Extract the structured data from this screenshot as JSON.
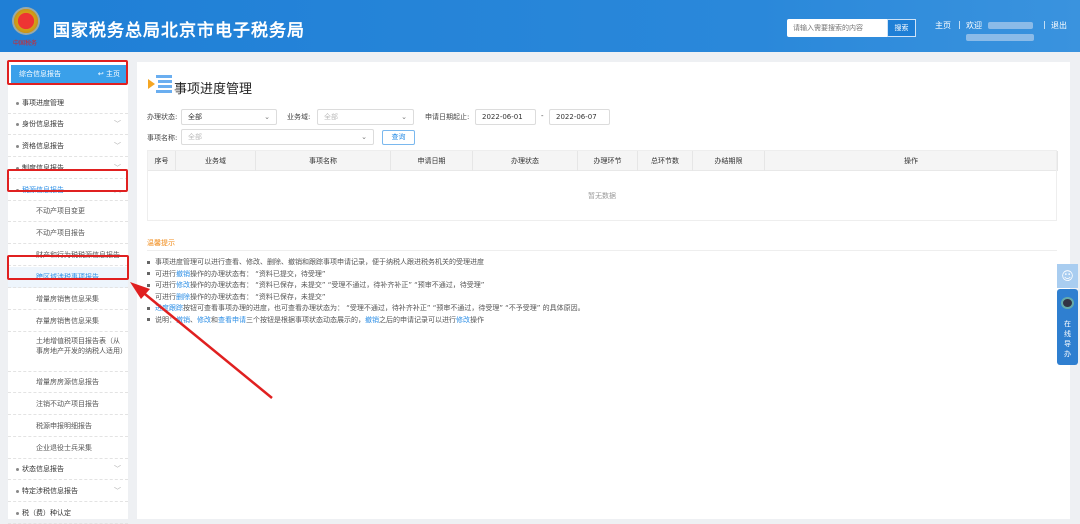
{
  "header": {
    "title": "国家税务总局北京市电子税务局",
    "emblem_text": "中国税务",
    "search_placeholder": "请输入需要搜索的内容",
    "search_button": "搜索",
    "home": "主页",
    "welcome": "欢迎",
    "logout": "退出",
    "separator": "|"
  },
  "sidebar": {
    "head": {
      "label": "综合信息报告",
      "home": "主页"
    },
    "items": [
      {
        "label": "事项进度管理",
        "level": 1
      },
      {
        "label": "身份信息报告",
        "level": 1,
        "chevron": "﹀"
      },
      {
        "label": "资格信息报告",
        "level": 1,
        "chevron": "﹀"
      },
      {
        "label": "制度信息报告",
        "level": 1,
        "chevron": "﹀"
      },
      {
        "label": "税源信息报告",
        "level": 1,
        "chevron": "︿",
        "active": true
      },
      {
        "label": "不动产项目变更",
        "level": 2
      },
      {
        "label": "不动产项目报告",
        "level": 2
      },
      {
        "label": "财产和行为税税源信息报告",
        "level": 2
      },
      {
        "label": "跨区域涉税事项报告",
        "level": 2,
        "selected": true
      },
      {
        "label": "增量房销售信息采集",
        "level": 2
      },
      {
        "label": "存量房销售信息采集",
        "level": 2
      },
      {
        "label": "土地增值税项目报告表（从事房地产开发的纳税人适用）",
        "level": 2
      },
      {
        "label": "增量房房源信息报告",
        "level": 2
      },
      {
        "label": "注销不动产项目报告",
        "level": 2
      },
      {
        "label": "税源申报明细报告",
        "level": 2
      },
      {
        "label": "企业退役士兵采集",
        "level": 2
      },
      {
        "label": "状态信息报告",
        "level": 1,
        "chevron": "﹀"
      },
      {
        "label": "特定涉税信息报告",
        "level": 1,
        "chevron": "﹀"
      },
      {
        "label": "税（费）种认定",
        "level": 1
      }
    ]
  },
  "main": {
    "title": "事项进度管理",
    "filters": {
      "status_label": "办理状态:",
      "status_value": "全部",
      "domain_label": "业务域:",
      "domain_placeholder": "全部",
      "date_label": "申请日期起止:",
      "date_from": "2022-06-01",
      "date_sep": "-",
      "date_to": "2022-06-07",
      "name_label": "事项名称:",
      "name_placeholder": "全部",
      "query_button": "查询"
    },
    "table": {
      "columns": [
        "序号",
        "业务域",
        "事项名称",
        "申请日期",
        "办理状态",
        "办理环节",
        "总环节数",
        "办结期限",
        "操作"
      ],
      "empty": "暂无数据"
    },
    "tips": {
      "title": "温馨提示",
      "lines": [
        {
          "bullet": true,
          "segments": [
            {
              "t": "事项进度管理可以进行查看、修改、删除、撤销和跟踪事项申请记录，便于纳税人跟进税务机关的受理进度"
            }
          ]
        },
        {
          "bullet": true,
          "segments": [
            {
              "t": "可进行"
            },
            {
              "t": "撤销",
              "link": true
            },
            {
              "t": "操作的办理状态有：  “资料已提交，待受理”"
            }
          ]
        },
        {
          "bullet": true,
          "segments": [
            {
              "t": "可进行"
            },
            {
              "t": "修改",
              "link": true
            },
            {
              "t": "操作的办理状态有：  “资料已保存，未提交”    “受理不通过，待补齐补正”    “预审不通过，待受理”"
            }
          ]
        },
        {
          "bullet": false,
          "segments": [
            {
              "t": "可进行"
            },
            {
              "t": "删除",
              "link": true
            },
            {
              "t": "操作的办理状态有：  “资料已保存，未提交”"
            }
          ]
        },
        {
          "bullet": true,
          "segments": [
            {
              "t": "进度跟踪",
              "link": true
            },
            {
              "t": "按钮可查看事项办理的进度，也可查看办理状态为：  “受理不通过，待补齐补正”    “预审不通过，待受理”    “不予受理”  的具体原因。"
            }
          ]
        },
        {
          "bullet": true,
          "segments": [
            {
              "t": "说明："
            },
            {
              "t": "撤销",
              "link": true
            },
            {
              "t": "、"
            },
            {
              "t": "修改",
              "link": true
            },
            {
              "t": "和"
            },
            {
              "t": "查看申请",
              "link": true
            },
            {
              "t": "三个按钮是根据事项状态动态展示的，"
            },
            {
              "t": "撤销",
              "link": true
            },
            {
              "t": "之后的申请记录可以进行"
            },
            {
              "t": "修改",
              "link": true
            },
            {
              "t": "操作"
            }
          ]
        }
      ]
    }
  },
  "float_widget": {
    "label": "在线导办"
  },
  "colors": {
    "header": "#1f7fd6",
    "accent": "#2b8ee6",
    "annotation": "#e02020",
    "tips_title": "#f08a17"
  }
}
